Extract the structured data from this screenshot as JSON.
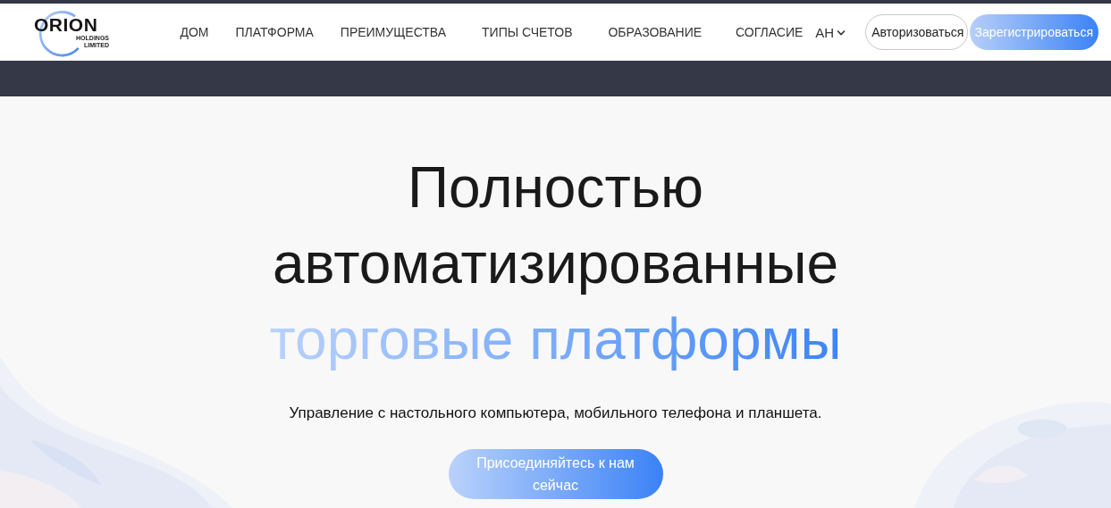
{
  "logo": {
    "name": "ORION",
    "tagline": [
      "HOLDINGS",
      "LIMITED"
    ]
  },
  "nav": [
    {
      "label": "ДОМ"
    },
    {
      "label": "ПЛАТФОРМА"
    },
    {
      "label": "ПРЕИМУЩЕСТВА"
    },
    {
      "label": "ТИПЫ СЧЕТОВ"
    },
    {
      "label": "ОБРАЗОВАНИЕ"
    },
    {
      "label": "СОГЛАСИЕ"
    }
  ],
  "language": {
    "label": "АН"
  },
  "login_button": {
    "label": "Авторизоваться"
  },
  "register_button": {
    "label": "Зарегистрироваться"
  },
  "hero": {
    "title_lines": [
      "Полностью",
      "автоматизированные"
    ],
    "title_highlight": "торговые платформы",
    "subtitle": "Управление с настольного компьютера, мобильного телефона и планшета.",
    "cta": "Присоединяйтесь к нам сейчас"
  }
}
